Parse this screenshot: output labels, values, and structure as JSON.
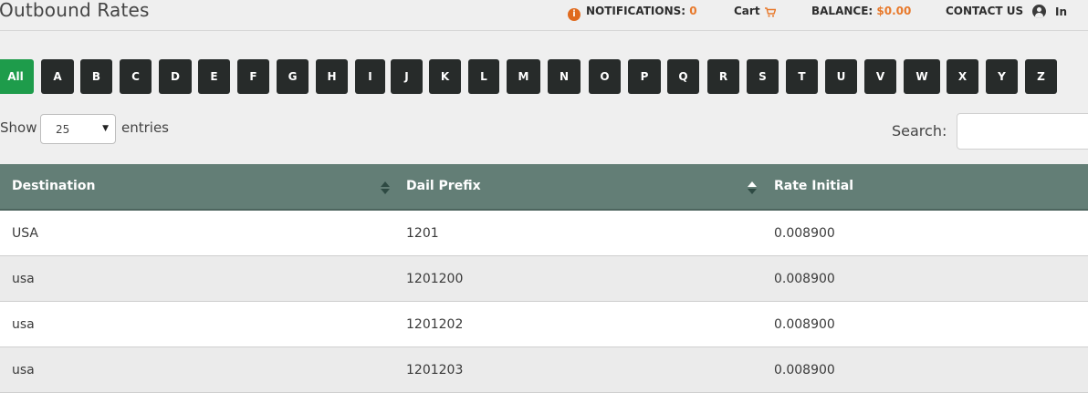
{
  "page": {
    "title": "Outbound Rates"
  },
  "nav": {
    "notifications_label": "NOTIFICATIONS:",
    "notifications_count": "0",
    "cart_label": "Cart",
    "balance_label": "BALANCE:",
    "balance_value": "$0.00",
    "contact_label": "CONTACT US",
    "user_label": "In",
    "accent_color": "#e8792b"
  },
  "filters": {
    "all_label": "All",
    "letters": [
      "A",
      "B",
      "C",
      "D",
      "E",
      "F",
      "G",
      "H",
      "I",
      "J",
      "K",
      "L",
      "M",
      "N",
      "O",
      "P",
      "Q",
      "R",
      "S",
      "T",
      "U",
      "V",
      "W",
      "X",
      "Y",
      "Z"
    ],
    "active": "All",
    "active_color": "#1e9c4b",
    "button_color": "#272b2a"
  },
  "controls": {
    "show_label": "Show",
    "entries_value": "25",
    "entries_label": "entries",
    "search_label": "Search:",
    "search_value": ""
  },
  "table": {
    "header_color": "#637e76",
    "columns": [
      "Destination",
      "Dail Prefix",
      "Rate Initial"
    ],
    "rows": [
      [
        "USA",
        "1201",
        "0.008900"
      ],
      [
        "usa",
        "1201200",
        "0.008900"
      ],
      [
        "usa",
        "1201202",
        "0.008900"
      ],
      [
        "usa",
        "1201203",
        "0.008900"
      ]
    ]
  }
}
